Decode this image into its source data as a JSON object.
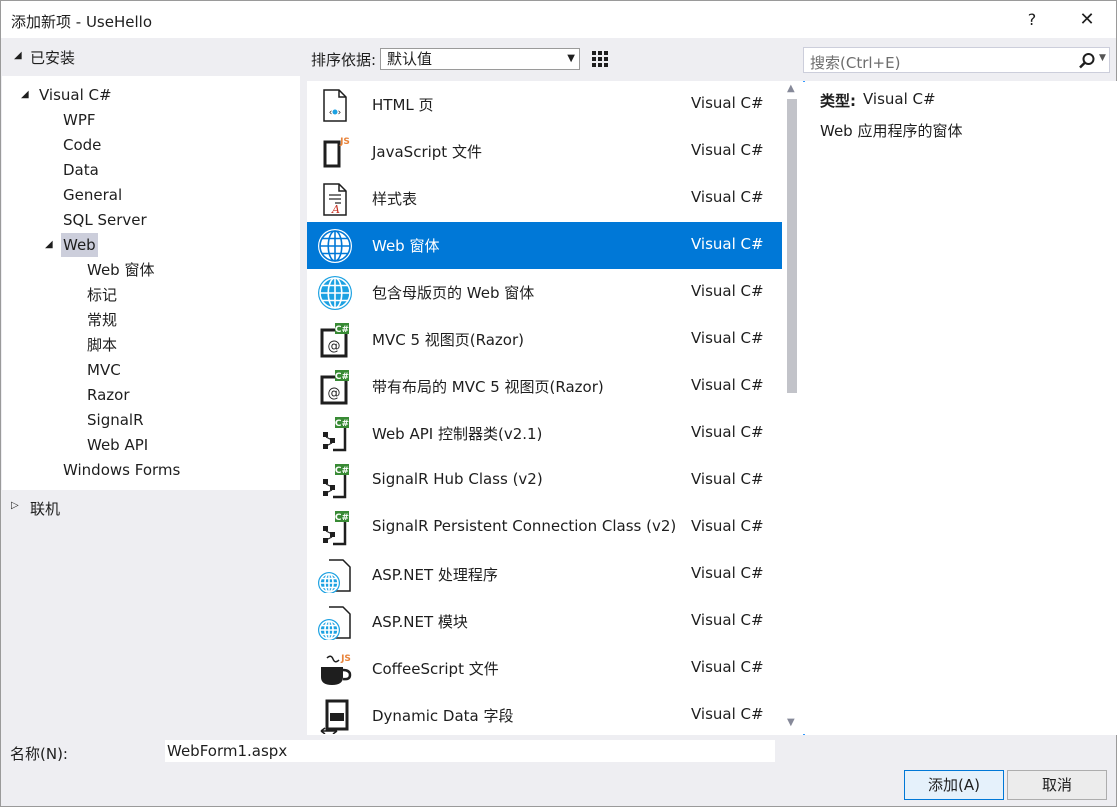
{
  "window": {
    "title": "添加新项 - UseHello",
    "help": "?",
    "close": "✕"
  },
  "left": {
    "installed": "已安装",
    "tree": [
      {
        "label": "Visual C#",
        "indent": 1,
        "caret": "◢"
      },
      {
        "label": "WPF",
        "indent": 2
      },
      {
        "label": "Code",
        "indent": 2
      },
      {
        "label": "Data",
        "indent": 2
      },
      {
        "label": "General",
        "indent": 2
      },
      {
        "label": "SQL Server",
        "indent": 2
      },
      {
        "label": "Web",
        "indent": 2,
        "caret": "◢",
        "selected": true
      },
      {
        "label": "Web 窗体",
        "indent": 3
      },
      {
        "label": "标记",
        "indent": 3
      },
      {
        "label": "常规",
        "indent": 3
      },
      {
        "label": "脚本",
        "indent": 3
      },
      {
        "label": "MVC",
        "indent": 3
      },
      {
        "label": "Razor",
        "indent": 3
      },
      {
        "label": "SignalR",
        "indent": 3
      },
      {
        "label": "Web API",
        "indent": 3
      },
      {
        "label": "Windows Forms",
        "indent": 2
      }
    ],
    "online": "联机"
  },
  "toolbar": {
    "sort_label": "排序依据:",
    "sort_value": "默认值",
    "search_placeholder": "搜索(Ctrl+E)"
  },
  "items": [
    {
      "name": "HTML 页",
      "type": "Visual C#",
      "icon": "html-page-icon"
    },
    {
      "name": "JavaScript 文件",
      "type": "Visual C#",
      "icon": "javascript-file-icon"
    },
    {
      "name": "样式表",
      "type": "Visual C#",
      "icon": "stylesheet-icon"
    },
    {
      "name": "Web 窗体",
      "type": "Visual C#",
      "icon": "globe-icon",
      "selected": true
    },
    {
      "name": "包含母版页的 Web 窗体",
      "type": "Visual C#",
      "icon": "globe-icon"
    },
    {
      "name": "MVC 5 视图页(Razor)",
      "type": "Visual C#",
      "icon": "razor-view-icon"
    },
    {
      "name": "带有布局的 MVC 5 视图页(Razor)",
      "type": "Visual C#",
      "icon": "razor-view-icon"
    },
    {
      "name": "Web API 控制器类(v2.1)",
      "type": "Visual C#",
      "icon": "csharp-class-icon"
    },
    {
      "name": "SignalR Hub Class (v2)",
      "type": "Visual C#",
      "icon": "csharp-class-icon"
    },
    {
      "name": "SignalR Persistent Connection Class (v2)",
      "type": "Visual C#",
      "icon": "csharp-class-icon"
    },
    {
      "name": "ASP.NET 处理程序",
      "type": "Visual C#",
      "icon": "aspnet-globe-file-icon"
    },
    {
      "name": "ASP.NET 模块",
      "type": "Visual C#",
      "icon": "aspnet-globe-file-icon"
    },
    {
      "name": "CoffeeScript 文件",
      "type": "Visual C#",
      "icon": "coffeescript-icon"
    },
    {
      "name": "Dynamic Data 字段",
      "type": "Visual C#",
      "icon": "dynamic-data-icon"
    }
  ],
  "details": {
    "type_label": "类型:",
    "type_value": "Visual C#",
    "description": "Web 应用程序的窗体"
  },
  "bottom": {
    "name_label": "名称(N):",
    "name_value": "WebForm1.aspx",
    "add_label": "添加(A)",
    "cancel_label": "取消"
  },
  "colors": {
    "selection": "#0078d7",
    "tree_selection": "#cccedb",
    "chrome": "#eeeef2"
  }
}
